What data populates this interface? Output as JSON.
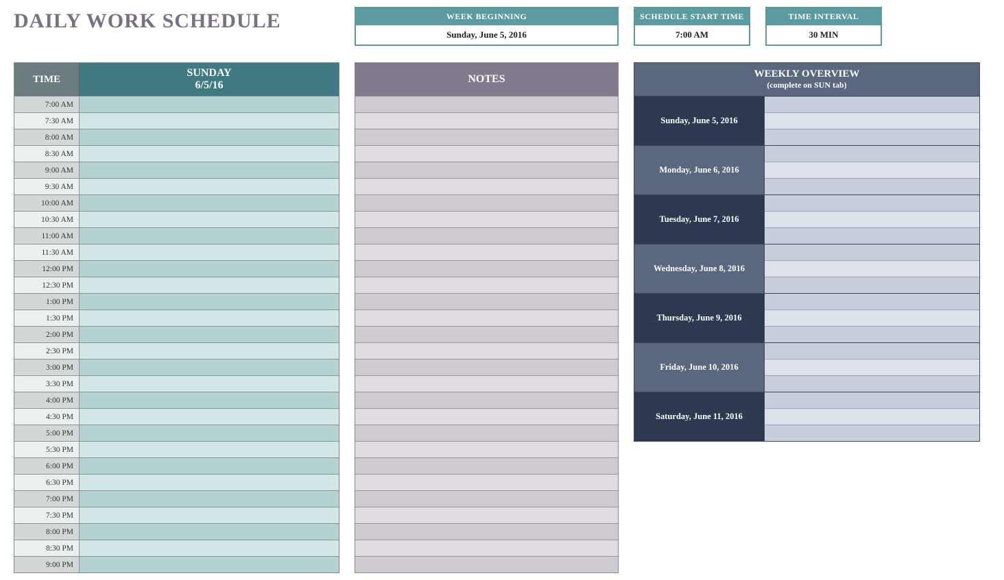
{
  "title": "DAILY WORK SCHEDULE",
  "info": {
    "week_beginning": {
      "label": "WEEK BEGINNING",
      "value": "Sunday, June 5, 2016"
    },
    "start_time": {
      "label": "SCHEDULE START TIME",
      "value": "7:00 AM"
    },
    "time_interval": {
      "label": "TIME INTERVAL",
      "value": "30 MIN"
    }
  },
  "schedule": {
    "time_header": "TIME",
    "day_name": "SUNDAY",
    "day_date": "6/5/16",
    "rows": [
      {
        "time": "7:00 AM",
        "value": ""
      },
      {
        "time": "7:30 AM",
        "value": ""
      },
      {
        "time": "8:00 AM",
        "value": ""
      },
      {
        "time": "8:30 AM",
        "value": ""
      },
      {
        "time": "9:00 AM",
        "value": ""
      },
      {
        "time": "9:30 AM",
        "value": ""
      },
      {
        "time": "10:00 AM",
        "value": ""
      },
      {
        "time": "10:30 AM",
        "value": ""
      },
      {
        "time": "11:00 AM",
        "value": ""
      },
      {
        "time": "11:30 AM",
        "value": ""
      },
      {
        "time": "12:00 PM",
        "value": ""
      },
      {
        "time": "12:30 PM",
        "value": ""
      },
      {
        "time": "1:00 PM",
        "value": ""
      },
      {
        "time": "1:30 PM",
        "value": ""
      },
      {
        "time": "2:00 PM",
        "value": ""
      },
      {
        "time": "2:30 PM",
        "value": ""
      },
      {
        "time": "3:00 PM",
        "value": ""
      },
      {
        "time": "3:30 PM",
        "value": ""
      },
      {
        "time": "4:00 PM",
        "value": ""
      },
      {
        "time": "4:30 PM",
        "value": ""
      },
      {
        "time": "5:00 PM",
        "value": ""
      },
      {
        "time": "5:30 PM",
        "value": ""
      },
      {
        "time": "6:00 PM",
        "value": ""
      },
      {
        "time": "6:30 PM",
        "value": ""
      },
      {
        "time": "7:00 PM",
        "value": ""
      },
      {
        "time": "7:30 PM",
        "value": ""
      },
      {
        "time": "8:00 PM",
        "value": ""
      },
      {
        "time": "8:30 PM",
        "value": ""
      },
      {
        "time": "9:00 PM",
        "value": ""
      }
    ]
  },
  "notes": {
    "header": "NOTES",
    "row_count": 29
  },
  "weekly": {
    "header": "WEEKLY OVERVIEW",
    "subheader": "(complete on SUN tab)",
    "days": [
      {
        "date": "Sunday, June 5, 2016",
        "lines": [
          "",
          "",
          ""
        ]
      },
      {
        "date": "Monday, June 6, 2016",
        "lines": [
          "",
          "",
          ""
        ]
      },
      {
        "date": "Tuesday, June 7, 2016",
        "lines": [
          "",
          "",
          ""
        ]
      },
      {
        "date": "Wednesday, June 8, 2016",
        "lines": [
          "",
          "",
          ""
        ]
      },
      {
        "date": "Thursday, June 9, 2016",
        "lines": [
          "",
          "",
          ""
        ]
      },
      {
        "date": "Friday, June 10, 2016",
        "lines": [
          "",
          "",
          ""
        ]
      },
      {
        "date": "Saturday, June 11, 2016",
        "lines": [
          "",
          "",
          ""
        ]
      }
    ]
  }
}
